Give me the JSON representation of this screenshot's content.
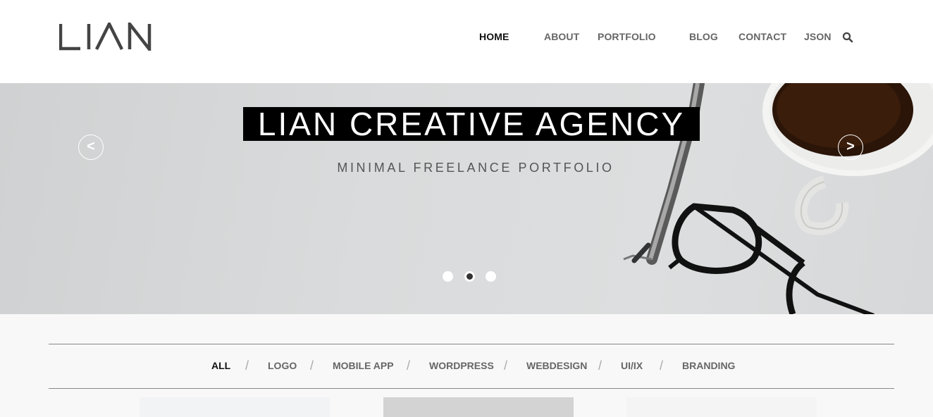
{
  "brand": {
    "logo_text": "LIAN"
  },
  "nav": {
    "items": [
      {
        "label": "HOME",
        "active": true
      },
      {
        "label": "ABOUT",
        "active": false
      },
      {
        "label": "PORTFOLIO",
        "active": false
      },
      {
        "label": "BLOG",
        "active": false
      },
      {
        "label": "CONTACT",
        "active": false
      },
      {
        "label": "JSON",
        "active": false
      }
    ],
    "search_icon": "search-icon"
  },
  "hero": {
    "title": "LIAN CREATIVE AGENCY",
    "subtitle": "MINIMAL FREELANCE PORTFOLIO",
    "prev_label": "<",
    "next_label": ">",
    "slides": {
      "count": 3,
      "active_index": 1
    }
  },
  "filter": {
    "items": [
      {
        "label": "ALL",
        "active": true
      },
      {
        "label": "LOGO",
        "active": false
      },
      {
        "label": "MOBILE APP",
        "active": false
      },
      {
        "label": "WORDPRESS",
        "active": false
      },
      {
        "label": "WEBDESIGN",
        "active": false
      },
      {
        "label": "UI/IX",
        "active": false
      },
      {
        "label": "BRANDING",
        "active": false
      }
    ],
    "separator": "/"
  },
  "colors": {
    "accent": "#000000",
    "nav_active": "#111111",
    "nav_default": "#666666"
  }
}
